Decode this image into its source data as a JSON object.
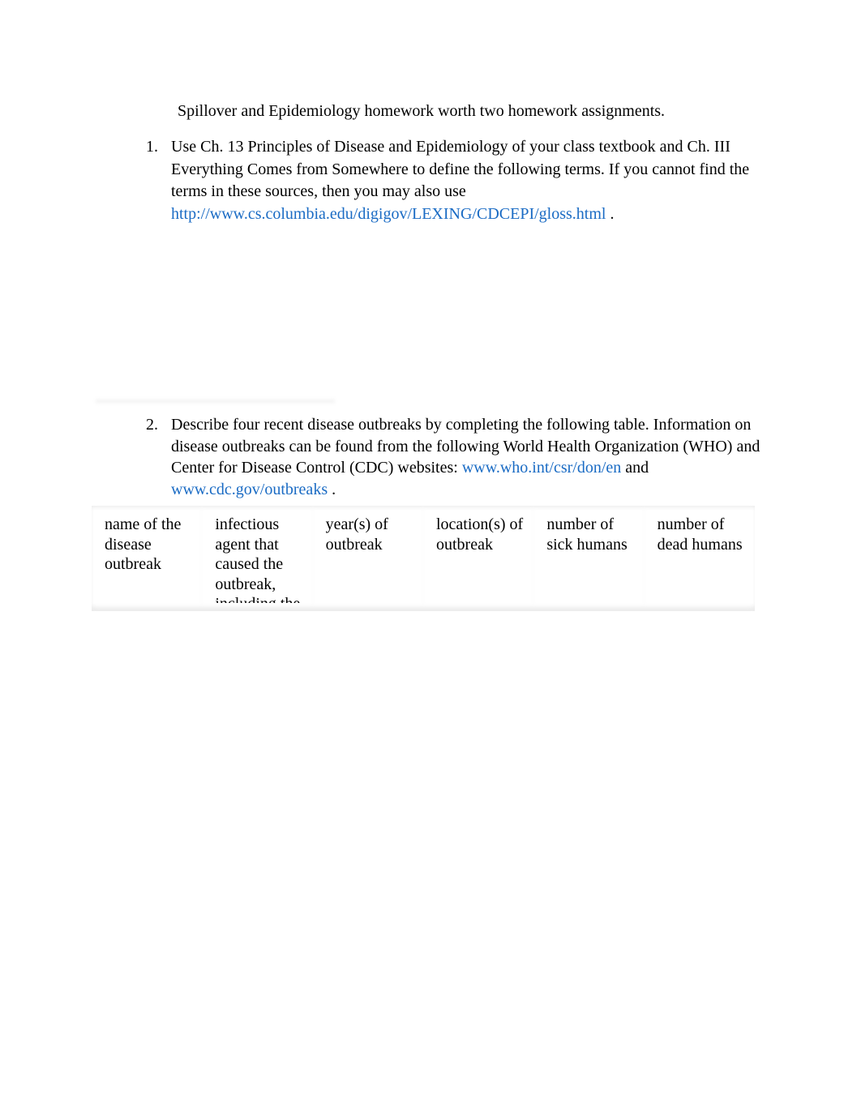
{
  "document": {
    "title": "Spillover and Epidemiology homework worth two homework assignments.",
    "items": [
      {
        "number": "1.",
        "text": "Use Ch. 13 Principles of Disease and Epidemiology of your class textbook and Ch. III Everything Comes from Somewhere to define the following terms. If you cannot find the terms in these sources, then you may also use ",
        "link": "http://www.cs.columbia.edu/digigov/LEXING/CDCEPI/gloss.html",
        "after": " ."
      },
      {
        "number": "2.",
        "text": "Describe four recent disease outbreaks by completing the following table. Information on disease outbreaks can be found from the following World Health Organization (WHO) and Center for Disease Control (CDC) websites: ",
        "link1": "www.who.int/csr/don/en",
        "between": " and ",
        "link2": "www.cdc.gov/outbreaks",
        "after": " ."
      }
    ],
    "table": {
      "headers": [
        "name of the disease outbreak",
        "infectious agent that caused the outbreak, including the",
        "year(s) of outbreak",
        "location(s) of outbreak",
        "number of sick humans",
        "number of dead humans"
      ]
    },
    "colors": {
      "link": "#1a6bc4",
      "text": "#000000"
    }
  }
}
